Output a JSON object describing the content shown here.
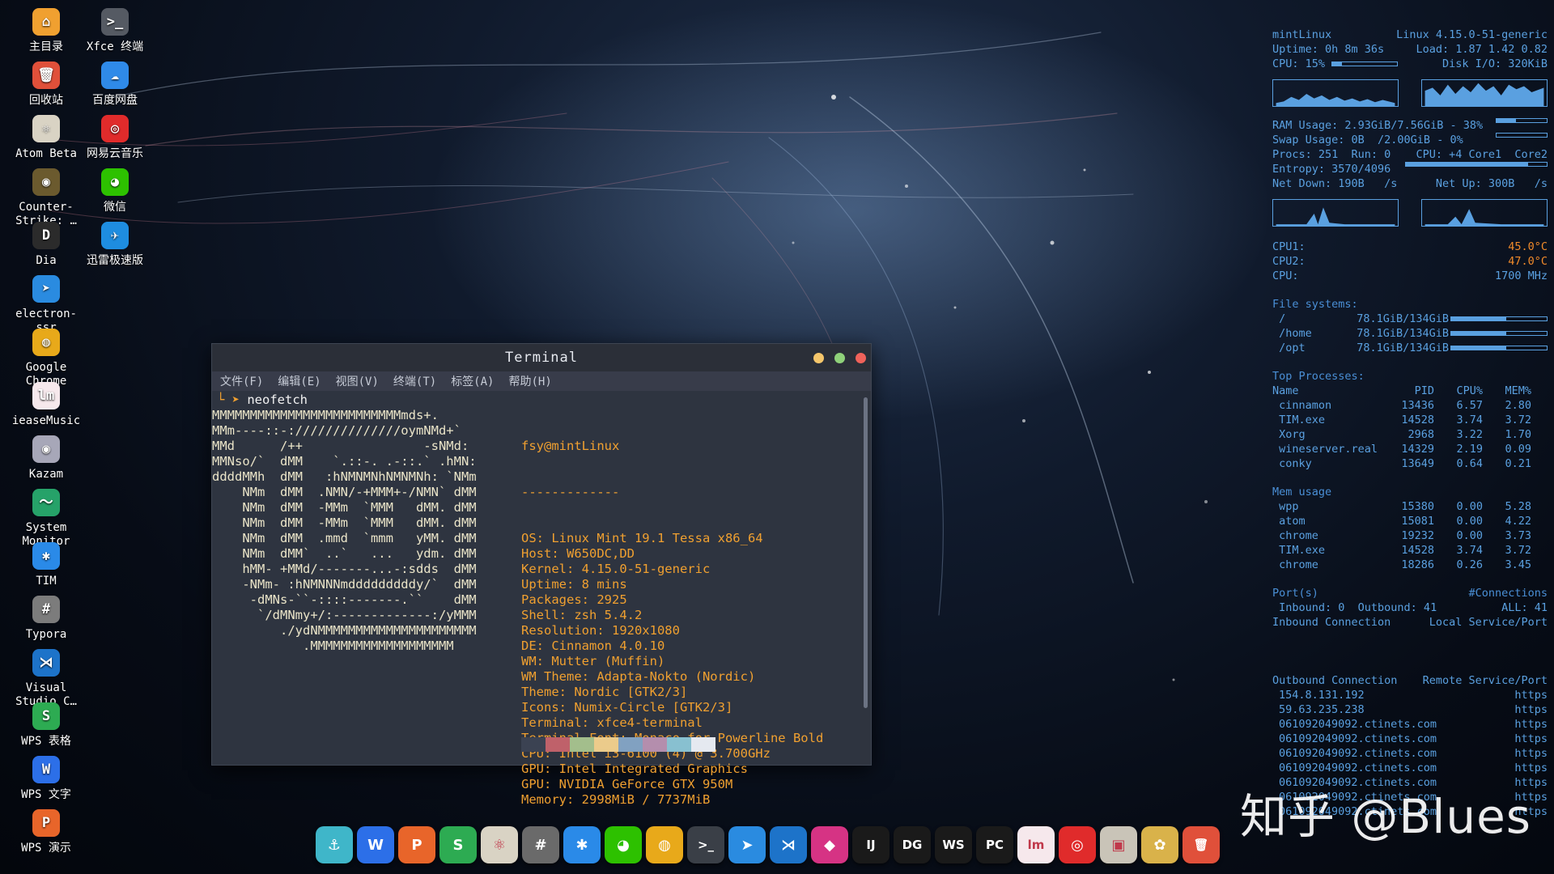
{
  "desktop_icons": [
    {
      "label": "主目录",
      "icon": "home-folder-icon",
      "glyph": "⌂",
      "color": "#f0a030"
    },
    {
      "label": "Xfce 终端",
      "icon": "terminal-icon",
      "glyph": ">_",
      "color": "#555a63"
    },
    {
      "label": "回收站",
      "icon": "trash-icon",
      "glyph": "🗑",
      "color": "#e0503a"
    },
    {
      "label": "百度网盘",
      "icon": "baidu-netdisk-icon",
      "glyph": "☁",
      "color": "#2f8ae8"
    },
    {
      "label": "Atom Beta",
      "icon": "atom-icon",
      "glyph": "⚛",
      "color": "#d9d3c4"
    },
    {
      "label": "网易云音乐",
      "icon": "netease-music-icon",
      "glyph": "◎",
      "color": "#e02b2b"
    },
    {
      "label": "Counter-Strike: …",
      "icon": "counter-strike-icon",
      "glyph": "◉",
      "color": "#6b5a2e"
    },
    {
      "label": "微信",
      "icon": "wechat-icon",
      "glyph": "◕",
      "color": "#2dc100"
    },
    {
      "label": "Dia",
      "icon": "dia-icon",
      "glyph": "D",
      "color": "#2b2b2b"
    },
    {
      "label": "迅雷极速版",
      "icon": "xunlei-icon",
      "glyph": "✈",
      "color": "#1e8de0"
    },
    {
      "label": "electron-ssr",
      "icon": "paper-plane-icon",
      "glyph": "➤",
      "color": "#2a8be0"
    },
    {
      "label": "Google Chrome",
      "icon": "chrome-icon",
      "glyph": "◍",
      "color": "#e8a91a"
    },
    {
      "label": "ieaseMusic",
      "icon": "iease-music-icon",
      "glyph": "lm",
      "color": "#f6e8ec"
    },
    {
      "label": "Kazam",
      "icon": "kazam-icon",
      "glyph": "◉",
      "color": "#a7a7b8"
    },
    {
      "label": "System Monitor",
      "icon": "system-monitor-icon",
      "glyph": "〜",
      "color": "#26a269"
    },
    {
      "label": "TIM",
      "icon": "tim-icon",
      "glyph": "✱",
      "color": "#2a8ae8"
    },
    {
      "label": "Typora",
      "icon": "typora-icon",
      "glyph": "#",
      "color": "#7c7c7c"
    },
    {
      "label": "Visual Studio C…",
      "icon": "vscode-icon",
      "glyph": "⋊",
      "color": "#1d73c9"
    },
    {
      "label": "WPS 表格",
      "icon": "wps-spreadsheet-icon",
      "glyph": "S",
      "color": "#2dab52"
    },
    {
      "label": "WPS 文字",
      "icon": "wps-writer-icon",
      "glyph": "W",
      "color": "#2c6fe8"
    },
    {
      "label": "WPS 演示",
      "icon": "wps-presentation-icon",
      "glyph": "P",
      "color": "#e8652a"
    }
  ],
  "conky": {
    "host": "mintLinux",
    "kernel": "Linux 4.15.0-51-generic",
    "uptime": "Uptime: 0h 8m 36s",
    "load": "Load: 1.87 1.42 0.82",
    "cpu": "CPU: 15%",
    "cpu_fraction": 0.15,
    "disk_io": "Disk I/O: 320KiB",
    "ram": "RAM Usage: 2.93GiB/7.56GiB - 38%",
    "ram_fraction": 0.38,
    "swap": "Swap Usage: 0B  /2.00GiB - 0%",
    "swap_fraction": 0.0,
    "procs": "Procs: 251  Run: 0",
    "cpu_cores": "CPU: +4 Core1  Core2",
    "entropy": "Entropy: 3570/4096",
    "entropy_fraction": 0.87,
    "net_down": "Net Down: 190B   /s",
    "net_up": "Net Up: 300B   /s",
    "cpu1_label": "CPU1:",
    "cpu1_temp": "45.0°C",
    "cpu2_label": "CPU2:",
    "cpu2_temp": "47.0°C",
    "cpu_freq_label": "CPU:",
    "cpu_freq": "1700 MHz",
    "fs_title": "File systems:",
    "filesystems": [
      {
        "mount": " /",
        "usage": "78.1GiB/134GiB",
        "fraction": 0.58
      },
      {
        "mount": " /home",
        "usage": "78.1GiB/134GiB",
        "fraction": 0.58
      },
      {
        "mount": " /opt",
        "usage": "78.1GiB/134GiB",
        "fraction": 0.58
      }
    ],
    "top_title": "Top Processes:",
    "top_headers": [
      "Name",
      "PID",
      "CPU%",
      "MEM%"
    ],
    "top_processes": [
      [
        " cinnamon",
        "13436",
        "6.57",
        "2.80"
      ],
      [
        " TIM.exe",
        "14528",
        "3.74",
        "3.72"
      ],
      [
        " Xorg",
        "2968",
        "3.22",
        "1.70"
      ],
      [
        " wineserver.real",
        "14329",
        "2.19",
        "0.09"
      ],
      [
        " conky",
        "13649",
        "0.64",
        "0.21"
      ]
    ],
    "mem_title": "Mem usage",
    "mem_processes": [
      [
        " wpp",
        "15380",
        "0.00",
        "5.28"
      ],
      [
        " atom",
        "15081",
        "0.00",
        "4.22"
      ],
      [
        " chrome",
        "19232",
        "0.00",
        "3.73"
      ],
      [
        " TIM.exe",
        "14528",
        "3.74",
        "3.72"
      ],
      [
        " chrome",
        "18286",
        "0.26",
        "3.45"
      ]
    ],
    "ports_title": "Port(s)",
    "connections_title": "#Connections",
    "ports_line": " Inbound: 0  Outbound: 41",
    "all_line": "ALL: 41",
    "inbound_conn": "Inbound Connection",
    "local_service": "Local Service/Port",
    "outbound_conn": "Outbound Connection",
    "remote_service": "Remote Service/Port",
    "connections": [
      [
        "154.8.131.192",
        "https"
      ],
      [
        "59.63.235.238",
        "https"
      ],
      [
        "061092049092.ctinets.com",
        "https"
      ],
      [
        "061092049092.ctinets.com",
        "https"
      ],
      [
        "061092049092.ctinets.com",
        "https"
      ],
      [
        "061092049092.ctinets.com",
        "https"
      ],
      [
        "061092049092.ctinets.com",
        "https"
      ],
      [
        "061092049092.ctinets.com",
        "https"
      ],
      [
        "061092049092.ctinets.com",
        "https"
      ]
    ]
  },
  "terminal": {
    "title": "Terminal",
    "menu": [
      "文件(F)",
      "编辑(E)",
      "视图(V)",
      "终端(T)",
      "标签(A)",
      "帮助(H)"
    ],
    "prompt_arrow": "└ ➤",
    "command": "neofetch",
    "logo": "MMMMMMMMMMMMMMMMMMMMMMMMMmds+.\nMMm----::-://////////////oymNMd+`\nMMd      /++                -sNMd:\nMMNso/`  dMM    `.::-. .-::.` .hMN:\nddddMMh  dMM   :hNMNMNhNMNMNh: `NMm\n    NMm  dMM  .NMN/-+MMM+-/NMN` dMM\n    NMm  dMM  -MMm  `MMM   dMM. dMM\n    NMm  dMM  -MMm  `MMM   dMM. dMM\n    NMm  dMM  .mmd  `mmm   yMM. dMM\n    NMm  dMM`  ..`   ...   ydm. dMM\n    hMM- +MMd/-------...-:sdds  dMM\n    -NMm- :hNMNNNmdddddddddy/`  dMM\n     -dMNs-``-::::-------.``    dMM\n      `/dMNmy+/:-------------:/yMMM\n         ./ydNMMMMMMMMMMMMMMMMMMMMM\n            .MMMMMMMMMMMMMMMMMMM",
    "info_user": "fsy@mintLinux",
    "info_sep": "-------------",
    "info": [
      "OS: Linux Mint 19.1 Tessa x86_64",
      "Host: W650DC,DD",
      "Kernel: 4.15.0-51-generic",
      "Uptime: 8 mins",
      "Packages: 2925",
      "Shell: zsh 5.4.2",
      "Resolution: 1920x1080",
      "DE: Cinnamon 4.0.10",
      "WM: Mutter (Muffin)",
      "WM Theme: Adapta-Nokto (Nordic)",
      "Theme: Nordic [GTK2/3]",
      "Icons: Numix-Circle [GTK2/3]",
      "Terminal: xfce4-terminal",
      "Terminal Font: Monaco for Powerline Bold",
      "CPU: Intel i3-6100 (4) @ 3.700GHz",
      "GPU: Intel Integrated Graphics",
      "GPU: NVIDIA GeForce GTX 950M",
      "Memory: 2998MiB / 7737MiB"
    ],
    "swatches": [
      "#3b4252",
      "#bf616a",
      "#a3be8c",
      "#ebcb8b",
      "#81a1c1",
      "#b48ead",
      "#88c0d0",
      "#e5e9f0"
    ]
  },
  "dock": [
    {
      "name": "anchor-icon",
      "glyph": "⚓",
      "color": "#3fb6c9"
    },
    {
      "name": "wps-writer-icon",
      "glyph": "W",
      "color": "#2c6fe8"
    },
    {
      "name": "wps-presentation-icon",
      "glyph": "P",
      "color": "#e8652a"
    },
    {
      "name": "wps-spreadsheet-icon",
      "glyph": "S",
      "color": "#2dab52"
    },
    {
      "name": "atom-icon",
      "glyph": "⚛",
      "color": "#d9d3c4"
    },
    {
      "name": "typora-icon",
      "glyph": "#",
      "color": "#6a6a6a"
    },
    {
      "name": "tim-icon",
      "glyph": "✱",
      "color": "#2a8ae8"
    },
    {
      "name": "wechat-icon",
      "glyph": "◕",
      "color": "#2dc100"
    },
    {
      "name": "chrome-icon",
      "glyph": "◍",
      "color": "#e8a91a"
    },
    {
      "name": "terminal-icon",
      "glyph": ">_",
      "color": "#3a3f47"
    },
    {
      "name": "telegram-icon",
      "glyph": "➤",
      "color": "#2a8be0"
    },
    {
      "name": "vscode-icon",
      "glyph": "⋊",
      "color": "#1d73c9"
    },
    {
      "name": "jetbrains-toolbox-icon",
      "glyph": "◆",
      "color": "#d63384"
    },
    {
      "name": "intellij-icon",
      "glyph": "IJ",
      "color": "#1a1a1a"
    },
    {
      "name": "datagrip-icon",
      "glyph": "DG",
      "color": "#1a1a1a"
    },
    {
      "name": "webstorm-icon",
      "glyph": "WS",
      "color": "#1a1a1a"
    },
    {
      "name": "pycharm-icon",
      "glyph": "PC",
      "color": "#1a1a1a"
    },
    {
      "name": "iease-music-icon",
      "glyph": "lm",
      "color": "#f6e8ec"
    },
    {
      "name": "netease-music-icon",
      "glyph": "◎",
      "color": "#e02b2b"
    },
    {
      "name": "image-viewer-icon",
      "glyph": "▣",
      "color": "#c9c4b8"
    },
    {
      "name": "settings-icon",
      "glyph": "✿",
      "color": "#d9b24a"
    },
    {
      "name": "trash-icon",
      "glyph": "🗑",
      "color": "#e0503a"
    }
  ],
  "watermark": "知乎 @Blues"
}
